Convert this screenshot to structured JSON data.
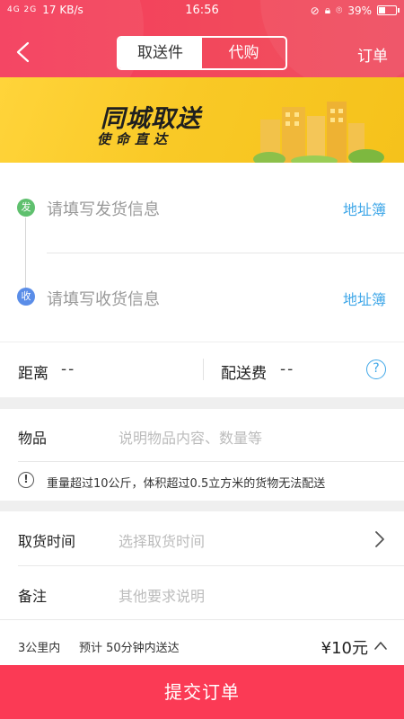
{
  "status_bar": {
    "network": "4G 2G",
    "speed": "17 KB/s",
    "time": "16:56",
    "battery": "39%"
  },
  "header": {
    "tabs": [
      {
        "label": "取送件",
        "active": true
      },
      {
        "label": "代购",
        "active": false
      }
    ],
    "order_link": "订单"
  },
  "banner": {
    "title": "同城取送",
    "subtitle": "使命直达"
  },
  "address": {
    "sender_badge": "发",
    "sender_placeholder": "请填写发货信息",
    "receiver_badge": "收",
    "receiver_placeholder": "请填写收货信息",
    "address_book": "地址簿"
  },
  "distance_row": {
    "distance_label": "距离",
    "distance_value": "--",
    "fee_label": "配送费",
    "fee_value": "--",
    "help_icon": "?"
  },
  "goods": {
    "label": "物品",
    "placeholder": "说明物品内容、数量等",
    "warning_icon": "!",
    "warning": "重量超过10公斤，体积超过0.5立方米的货物无法配送"
  },
  "details": {
    "pickup_time_label": "取货时间",
    "pickup_time_placeholder": "选择取货时间",
    "note_label": "备注",
    "note_placeholder": "其他要求说明"
  },
  "summary": {
    "range": "3公里内",
    "estimate": "预计 50分钟内送达",
    "price": "¥10元"
  },
  "submit_label": "提交订单",
  "colors": {
    "header": "#f24a5c",
    "accent_link": "#3fa7e8",
    "submit": "#fb3a55",
    "sender_badge": "#5fc06e",
    "receiver_badge": "#5a8de8"
  }
}
